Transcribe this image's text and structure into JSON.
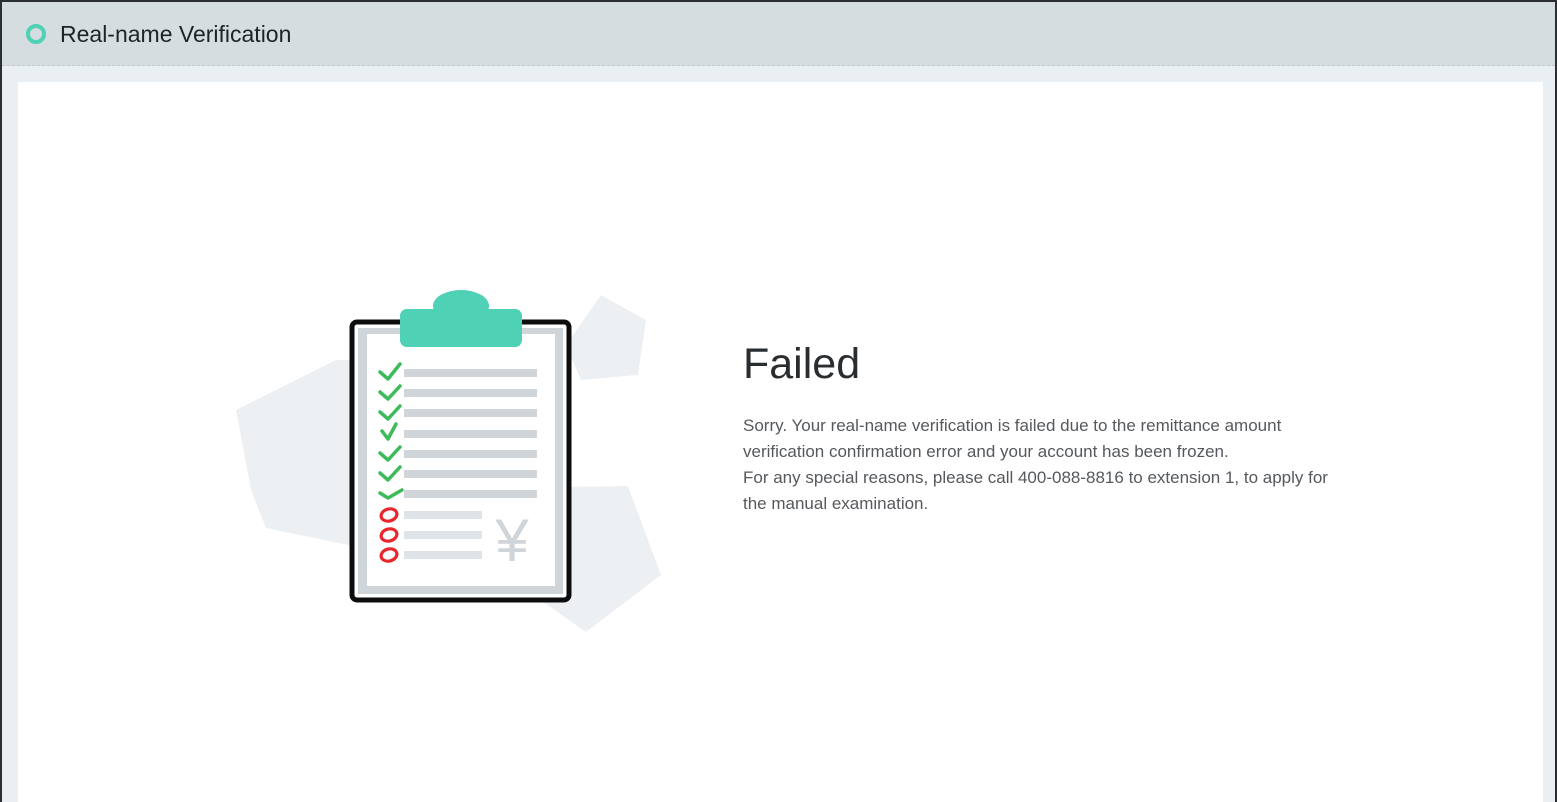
{
  "header": {
    "title": "Real-name Verification"
  },
  "result": {
    "status": "Failed",
    "message_lines": [
      "Sorry. Your real-name verification is failed due to the remittance amount verification confirmation error and your account has been frozen.",
      "For any special reasons, please call 400-088-8816 to extension 1, to apply for the manual examination."
    ]
  },
  "illustration": {
    "icon": "clipboard-checklist-icon",
    "currency_symbol": "¥",
    "checked_items": 7,
    "failed_items": 3
  },
  "colors": {
    "accent": "#4fd1b6",
    "check": "#3dbb5a",
    "fail": "#e8262b",
    "header_bg": "#d6dde0"
  }
}
